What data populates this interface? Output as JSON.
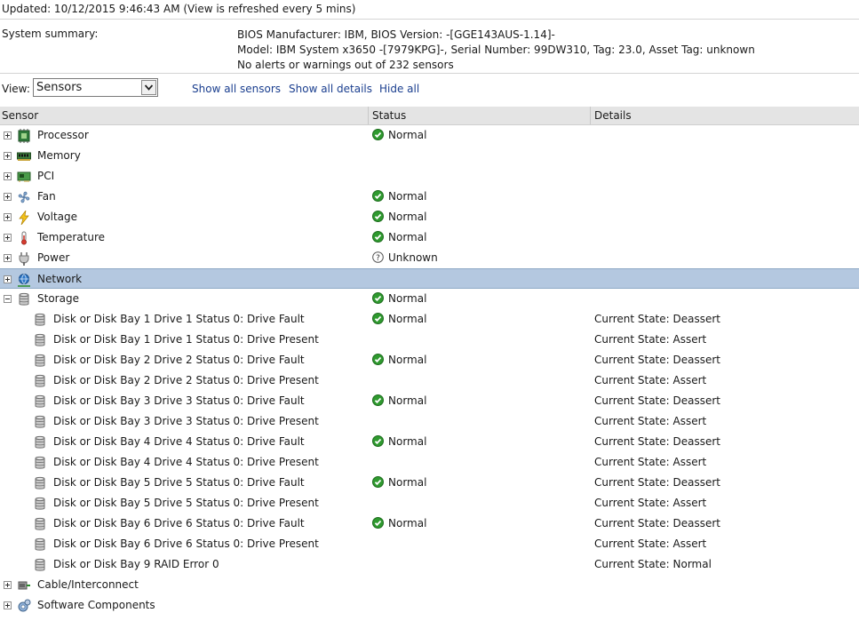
{
  "header": {
    "updated": "Updated: 10/12/2015  9:46:43 AM (View is refreshed every 5 mins)",
    "summary_label": "System summary:",
    "summary_lines": [
      "BIOS Manufacturer: IBM, BIOS Version: -[GGE143AUS-1.14]-",
      "Model: IBM System x3650 -[7979KPG]-, Serial Number: 99DW310, Tag: 23.0,  Asset Tag: unknown",
      "No alerts or warnings out of 232 sensors"
    ]
  },
  "view": {
    "label": "View:",
    "selected": "Sensors",
    "links": [
      "Show all sensors",
      "Show all details",
      "Hide all"
    ]
  },
  "columns": [
    "Sensor",
    "Status",
    "Details"
  ],
  "rows": [
    {
      "type": "group",
      "label": "Processor",
      "icon": "processor-icon",
      "status": "Normal",
      "state": "normal",
      "expanded": false
    },
    {
      "type": "group",
      "label": "Memory",
      "icon": "memory-icon",
      "status": "",
      "state": "",
      "expanded": false
    },
    {
      "type": "group",
      "label": "PCI",
      "icon": "pci-icon",
      "status": "",
      "state": "",
      "expanded": false
    },
    {
      "type": "group",
      "label": "Fan",
      "icon": "fan-icon",
      "status": "Normal",
      "state": "normal",
      "expanded": false
    },
    {
      "type": "group",
      "label": "Voltage",
      "icon": "voltage-icon",
      "status": "Normal",
      "state": "normal",
      "expanded": false
    },
    {
      "type": "group",
      "label": "Temperature",
      "icon": "temperature-icon",
      "status": "Normal",
      "state": "normal",
      "expanded": false
    },
    {
      "type": "group",
      "label": "Power",
      "icon": "power-icon",
      "status": "Unknown",
      "state": "unknown",
      "expanded": false
    },
    {
      "type": "group",
      "label": "Network",
      "icon": "network-icon",
      "status": "",
      "state": "",
      "expanded": false,
      "selected": true
    },
    {
      "type": "group",
      "label": "Storage",
      "icon": "storage-icon",
      "status": "Normal",
      "state": "normal",
      "expanded": true
    },
    {
      "type": "child",
      "label": "Disk or Disk Bay 1 Drive 1 Status 0: Drive Fault",
      "icon": "disk-icon",
      "status": "Normal",
      "state": "normal",
      "details": "Current State: Deassert"
    },
    {
      "type": "child",
      "label": "Disk or Disk Bay 1 Drive 1 Status 0: Drive Present",
      "icon": "disk-icon",
      "status": "",
      "state": "",
      "details": "Current State: Assert"
    },
    {
      "type": "child",
      "label": "Disk or Disk Bay 2 Drive 2 Status 0: Drive Fault",
      "icon": "disk-icon",
      "status": "Normal",
      "state": "normal",
      "details": "Current State: Deassert"
    },
    {
      "type": "child",
      "label": "Disk or Disk Bay 2 Drive 2 Status 0: Drive Present",
      "icon": "disk-icon",
      "status": "",
      "state": "",
      "details": "Current State: Assert"
    },
    {
      "type": "child",
      "label": "Disk or Disk Bay 3 Drive 3 Status 0: Drive Fault",
      "icon": "disk-icon",
      "status": "Normal",
      "state": "normal",
      "details": "Current State: Deassert"
    },
    {
      "type": "child",
      "label": "Disk or Disk Bay 3 Drive 3 Status 0: Drive Present",
      "icon": "disk-icon",
      "status": "",
      "state": "",
      "details": "Current State: Assert"
    },
    {
      "type": "child",
      "label": "Disk or Disk Bay 4 Drive 4 Status 0: Drive Fault",
      "icon": "disk-icon",
      "status": "Normal",
      "state": "normal",
      "details": "Current State: Deassert"
    },
    {
      "type": "child",
      "label": "Disk or Disk Bay 4 Drive 4 Status 0: Drive Present",
      "icon": "disk-icon",
      "status": "",
      "state": "",
      "details": "Current State: Assert"
    },
    {
      "type": "child",
      "label": "Disk or Disk Bay 5 Drive 5 Status 0: Drive Fault",
      "icon": "disk-icon",
      "status": "Normal",
      "state": "normal",
      "details": "Current State: Deassert"
    },
    {
      "type": "child",
      "label": "Disk or Disk Bay 5 Drive 5 Status 0: Drive Present",
      "icon": "disk-icon",
      "status": "",
      "state": "",
      "details": "Current State: Assert"
    },
    {
      "type": "child",
      "label": "Disk or Disk Bay 6 Drive 6 Status 0: Drive Fault",
      "icon": "disk-icon",
      "status": "Normal",
      "state": "normal",
      "details": "Current State: Deassert"
    },
    {
      "type": "child",
      "label": "Disk or Disk Bay 6 Drive 6 Status 0: Drive Present",
      "icon": "disk-icon",
      "status": "",
      "state": "",
      "details": "Current State: Assert"
    },
    {
      "type": "child",
      "label": "Disk or Disk Bay 9 RAID Error 0",
      "icon": "disk-icon",
      "status": "",
      "state": "",
      "details": "Current State: Normal"
    },
    {
      "type": "group",
      "label": "Cable/Interconnect",
      "icon": "cable-icon",
      "status": "",
      "state": "",
      "expanded": false
    },
    {
      "type": "group",
      "label": "Software Components",
      "icon": "software-icon",
      "status": "",
      "state": "",
      "expanded": false
    }
  ]
}
